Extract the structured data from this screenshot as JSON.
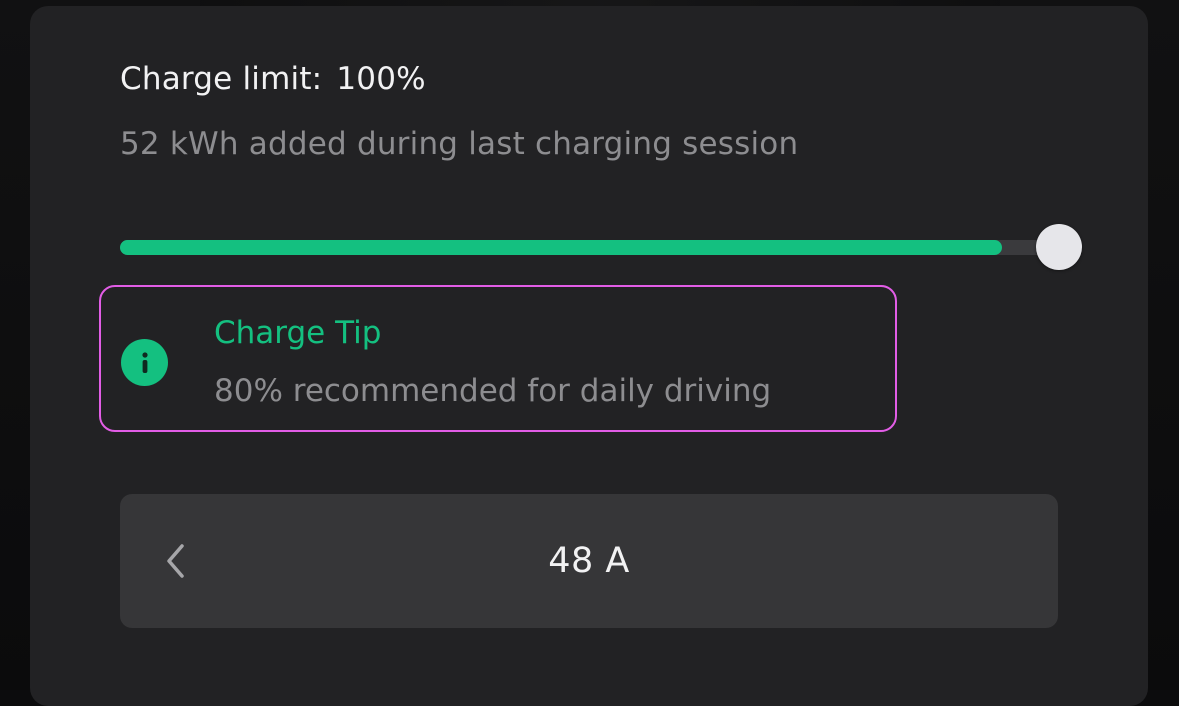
{
  "charge_limit": {
    "label": "Charge limit:",
    "value": "100%",
    "fraction": 1.0
  },
  "session": {
    "text": "52 kWh added during last charging session"
  },
  "tip": {
    "icon": "info-icon",
    "icon_glyph": "i",
    "title": "Charge Tip",
    "body": "80% recommended for daily driving"
  },
  "amperage": {
    "value": "48 A",
    "prev_icon": "chevron-left-icon"
  },
  "colors": {
    "accent": "#14c080",
    "highlight_border": "#e25de6",
    "panel": "#222224",
    "control": "#363638"
  }
}
